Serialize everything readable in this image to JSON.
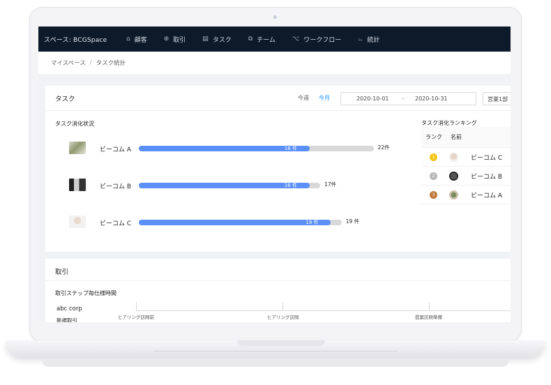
{
  "nav": {
    "space": "スペース: BCGSpace",
    "items": [
      {
        "icon": "⌂",
        "label": "顧客"
      },
      {
        "icon": "⊕",
        "label": "取引"
      },
      {
        "icon": "▤",
        "label": "タスク"
      },
      {
        "icon": "⧉",
        "label": "チーム"
      },
      {
        "icon": "⌥",
        "label": "ワークフロー"
      },
      {
        "icon": "⌳",
        "label": "統計"
      }
    ]
  },
  "breadcrumb": {
    "root": "マイスペース",
    "separator": "/",
    "current": "タスク統計"
  },
  "task_card": {
    "title": "タスク",
    "period_week": "今週",
    "period_month": "今月",
    "date_start": "2020-10-01",
    "date_separator": "~",
    "date_end": "2020-10-31",
    "department": "営業1部",
    "progress_title": "タスク消化状況",
    "rows": [
      {
        "name": "ビーコム A",
        "done": 16,
        "total": 22,
        "done_label": "16 件",
        "total_label": "22件"
      },
      {
        "name": "ビーコム B",
        "done": 16,
        "total": 17,
        "done_label": "16 件",
        "total_label": "17件"
      },
      {
        "name": "ビーコム C",
        "done": 18,
        "total": 19,
        "done_label": "18 件",
        "total_label": "19 件"
      }
    ],
    "ranking_title": "タスク消化ランキング",
    "ranking_headers": {
      "rank": "ランク",
      "name": "名前"
    },
    "ranking": [
      {
        "rank": "1",
        "name": "ビーコム C",
        "medal_color": "#f5c518"
      },
      {
        "rank": "2",
        "name": "ビーコム B",
        "medal_color": "#b8b8b8"
      },
      {
        "rank": "3",
        "name": "ビーコム A",
        "medal_color": "#c07a3a"
      }
    ]
  },
  "deal_card": {
    "title": "取引",
    "subtitle": "取引ステップ毎仕様時間",
    "row_company": "abc corp",
    "row_deal": "新規取引",
    "axis_labels": [
      "ヒアリング訪問前",
      "ヒアリング訪問",
      "提案訪問準備"
    ]
  },
  "colors": {
    "nav_bg": "#0c1a2a",
    "bar": "#5b8ff9",
    "track": "#d9d9d9",
    "accent": "#1890ff"
  }
}
